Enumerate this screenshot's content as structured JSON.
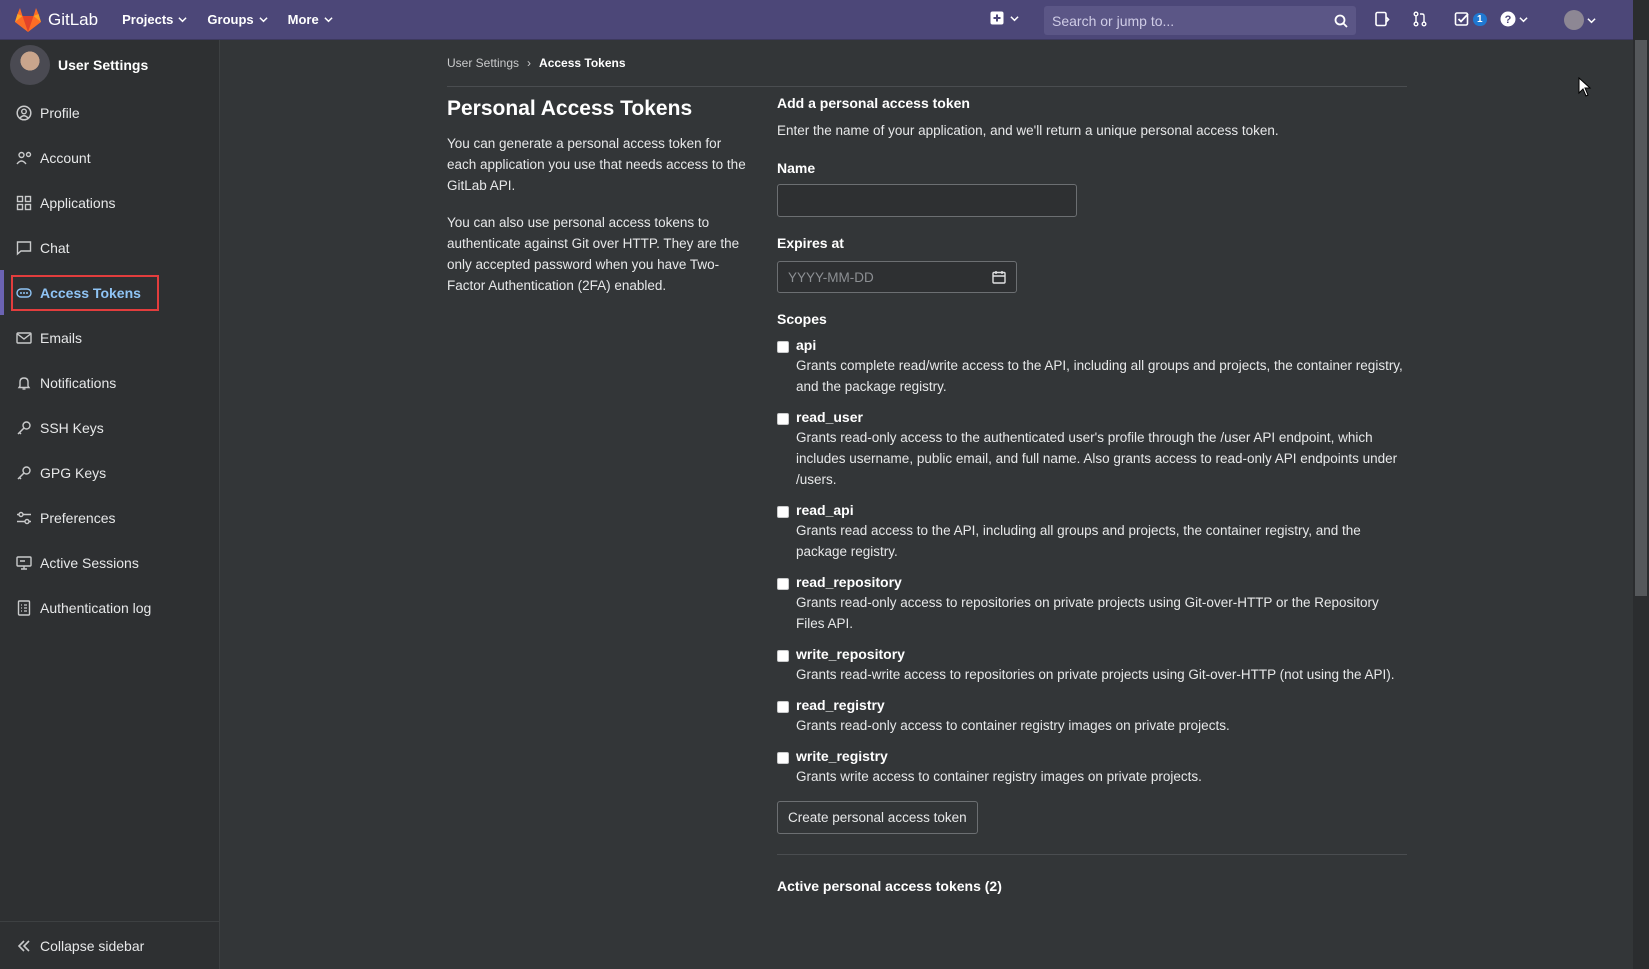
{
  "navbar": {
    "brand": "GitLab",
    "menu": [
      {
        "label": "Projects"
      },
      {
        "label": "Groups"
      },
      {
        "label": "More"
      }
    ],
    "search_placeholder": "Search or jump to...",
    "todo_count": "1"
  },
  "sidebar": {
    "title": "User Settings",
    "items": [
      {
        "label": "Profile",
        "icon": "profile-icon"
      },
      {
        "label": "Account",
        "icon": "account-icon"
      },
      {
        "label": "Applications",
        "icon": "applications-icon"
      },
      {
        "label": "Chat",
        "icon": "chat-icon"
      },
      {
        "label": "Access Tokens",
        "icon": "token-icon"
      },
      {
        "label": "Emails",
        "icon": "mail-icon"
      },
      {
        "label": "Notifications",
        "icon": "bell-icon"
      },
      {
        "label": "SSH Keys",
        "icon": "key-icon"
      },
      {
        "label": "GPG Keys",
        "icon": "key-icon"
      },
      {
        "label": "Preferences",
        "icon": "preferences-icon"
      },
      {
        "label": "Active Sessions",
        "icon": "monitor-icon"
      },
      {
        "label": "Authentication log",
        "icon": "log-icon"
      }
    ],
    "collapse_label": "Collapse sidebar"
  },
  "breadcrumb": {
    "parent": "User Settings",
    "current": "Access Tokens"
  },
  "intro": {
    "title": "Personal Access Tokens",
    "p1": "You can generate a personal access token for each application you use that needs access to the GitLab API.",
    "p2": "You can also use personal access tokens to authenticate against Git over HTTP. They are the only accepted password when you have Two-Factor Authentication (2FA) enabled."
  },
  "form": {
    "heading": "Add a personal access token",
    "description": "Enter the name of your application, and we'll return a unique personal access token.",
    "name_label": "Name",
    "name_value": "",
    "expires_label": "Expires at",
    "expires_placeholder": "YYYY-MM-DD",
    "scopes_label": "Scopes",
    "scopes": [
      {
        "name": "api",
        "desc": "Grants complete read/write access to the API, including all groups and projects, the container registry, and the package registry."
      },
      {
        "name": "read_user",
        "desc": "Grants read-only access to the authenticated user's profile through the /user API endpoint, which includes username, public email, and full name. Also grants access to read-only API endpoints under /users."
      },
      {
        "name": "read_api",
        "desc": "Grants read access to the API, including all groups and projects, the container registry, and the package registry."
      },
      {
        "name": "read_repository",
        "desc": "Grants read-only access to repositories on private projects using Git-over-HTTP or the Repository Files API."
      },
      {
        "name": "write_repository",
        "desc": "Grants read-write access to repositories on private projects using Git-over-HTTP (not using the API)."
      },
      {
        "name": "read_registry",
        "desc": "Grants read-only access to container registry images on private projects."
      },
      {
        "name": "write_registry",
        "desc": "Grants write access to container registry images on private projects."
      }
    ],
    "submit_label": "Create personal access token"
  },
  "active_tokens_title": "Active personal access tokens (2)",
  "colors": {
    "navbar": "#4c4778",
    "background": "#333638",
    "sidebar": "#2e3032",
    "active_link": "#8fc4f5",
    "highlight_box": "#e23d3d"
  }
}
